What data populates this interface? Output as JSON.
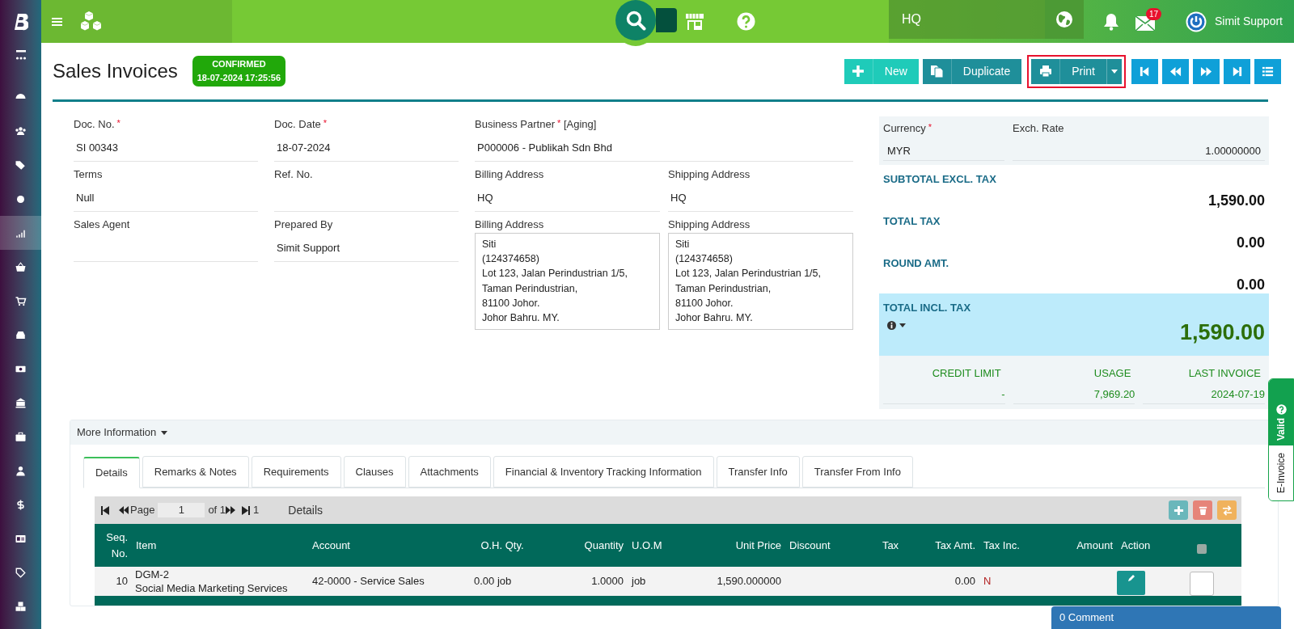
{
  "sidebar": {
    "items": [
      {
        "selected": false
      },
      {
        "selected": false
      },
      {
        "selected": false
      },
      {
        "selected": false
      },
      {
        "selected": true
      },
      {
        "selected": false
      },
      {
        "selected": false
      },
      {
        "selected": false
      },
      {
        "selected": false
      },
      {
        "selected": false
      },
      {
        "selected": false
      },
      {
        "selected": false
      },
      {
        "selected": false
      },
      {
        "selected": false
      },
      {
        "selected": false
      },
      {
        "selected": false
      }
    ]
  },
  "topbar": {
    "branch": "HQ",
    "mail_count": "17",
    "user": "Simit Support"
  },
  "header": {
    "title": "Sales Invoices",
    "status": "CONFIRMED",
    "status_time": "18-07-2024 17:25:56"
  },
  "toolbar": {
    "buttons": [
      {
        "label": "New",
        "kind": "new",
        "highlighted": false
      },
      {
        "label": "Duplicate",
        "kind": "duplicate",
        "highlighted": false
      },
      {
        "label": "Print",
        "kind": "print",
        "highlighted": true
      }
    ]
  },
  "form": {
    "columns": [
      [
        {
          "label": "Doc. No.",
          "required_mark": "*",
          "value": "SI 00343"
        },
        {
          "label": "Terms",
          "value": "Null"
        },
        {
          "label": "Sales Agent"
        }
      ],
      [
        {
          "label": "Doc. Date",
          "required_mark": "*",
          "value": "18-07-2024"
        },
        {
          "label": "Ref. No."
        },
        {
          "label": "Prepared By",
          "value": "Simit Support"
        }
      ]
    ],
    "business_partner": {
      "label": "Business Partner",
      "required_mark": "*",
      "suffix": "[Aging]",
      "value": "P000006 - Publikah Sdn Bhd"
    },
    "addresses": [
      [
        {
          "label": "Billing Address",
          "value": "HQ"
        },
        {
          "label": "Shipping Address",
          "value": "HQ"
        }
      ],
      [
        {
          "label": "Billing Address",
          "lines": [
            "Siti",
            "(124374658)",
            "Lot 123, Jalan Perindustrian 1/5,",
            "Taman Perindustrian,",
            "81100 Johor.",
            "Johor Bahru. MY."
          ]
        },
        {
          "label": "Shipping Address",
          "lines": [
            "Siti",
            "(124374658)",
            "Lot 123, Jalan Perindustrian 1/5,",
            "Taman Perindustrian,",
            "81100 Johor.",
            "Johor Bahru. MY."
          ]
        }
      ]
    ]
  },
  "summary": {
    "currency": {
      "label": "Currency",
      "required_mark": "*",
      "value": "MYR"
    },
    "rate": {
      "label": "Exch. Rate",
      "value": "1.00000000"
    },
    "totals": [
      {
        "label": "SUBTOTAL EXCL. TAX",
        "value": "1,590.00"
      },
      {
        "label": "TOTAL TAX",
        "value": "0.00"
      },
      {
        "label": "ROUND AMT.",
        "value": "0.00"
      }
    ],
    "grand_total": {
      "label": "TOTAL INCL. TAX",
      "value": "1,590.00"
    },
    "credit": [
      {
        "label": "CREDIT LIMIT",
        "value": "-"
      },
      {
        "label": "USAGE",
        "value": "7,969.20"
      },
      {
        "label": "LAST INVOICE",
        "value": "2024-07-19"
      }
    ]
  },
  "einvoice": {
    "status": "Valid",
    "label": "E-Invoice"
  },
  "more_information": "More Information",
  "tabs": [
    {
      "label": "Details",
      "selected": true
    },
    {
      "label": "Remarks & Notes",
      "selected": false
    },
    {
      "label": "Requirements",
      "selected": false
    },
    {
      "label": "Clauses",
      "selected": false
    },
    {
      "label": "Attachments",
      "selected": false
    },
    {
      "label": "Financial & Inventory Tracking Information",
      "selected": false
    },
    {
      "label": "Transfer Info",
      "selected": false
    },
    {
      "label": "Transfer From Info",
      "selected": false
    }
  ],
  "grid": {
    "page_label": "Page",
    "page": "1",
    "of": "of 1",
    "total": "1",
    "title": "Details",
    "select_all_checked": false,
    "columns": [
      "Seq. No.",
      "Item",
      "Account",
      "O.H. Qty.",
      "Quantity",
      "U.O.M",
      "Unit Price",
      "Discount",
      "Tax",
      "Tax Amt.",
      "Tax Inc.",
      "Amount",
      "Action"
    ],
    "rows": [
      {
        "seq": "10",
        "item_code": "DGM-2",
        "item_name": "Social Media Marketing Services",
        "account": "42-0000 - Service Sales",
        "oh_qty": "0.00 job",
        "quantity": "1.0000",
        "uom": "job",
        "unit_price": "1,590.000000",
        "tax_amt": "0.00",
        "tax_inc": "N",
        "checked": false
      }
    ]
  },
  "comments": "0 Comment"
}
